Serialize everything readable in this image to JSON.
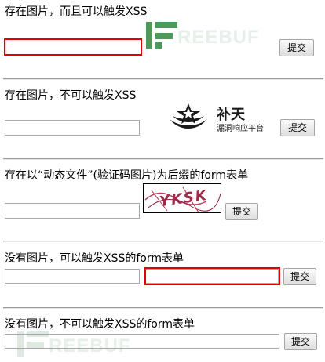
{
  "sections": [
    {
      "heading": "存在图片，而且可以触发XSS",
      "submit_label": "提交"
    },
    {
      "heading": "存在图片，不可以触发XSS",
      "submit_label": "提交"
    },
    {
      "heading": "存在以“动态文件”(验证码图片)为后缀的form表单",
      "submit_label": "提交"
    },
    {
      "heading": "没有图片，可以触发XSS的form表单",
      "submit_label": "提交"
    },
    {
      "heading": "没有图片，不可以触发XSS的form表单",
      "submit_label": "提交"
    }
  ],
  "watermark_top": "REEBUF",
  "watermark_bottom": "REEBUF",
  "butian_logo": {
    "title": "补天",
    "subtitle": "漏洞响应平台"
  },
  "captcha_text": "YKSK",
  "colors": {
    "highlight": "#e00000",
    "freebuf_green": "#4a9a5a"
  }
}
